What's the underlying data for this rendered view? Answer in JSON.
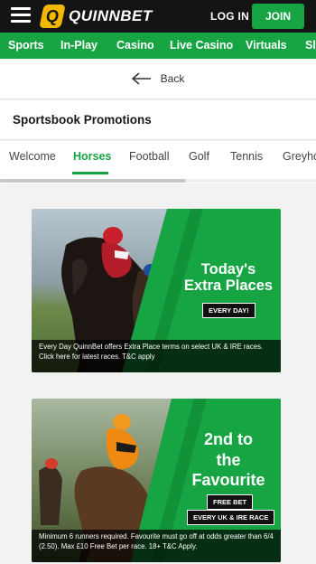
{
  "header": {
    "logo_letter": "Q",
    "logo_text": "QUINNBET",
    "login_label": "LOG IN",
    "join_label": "JOIN"
  },
  "nav": {
    "items": [
      "Sports",
      "In-Play",
      "Casino",
      "Live Casino",
      "Virtuals",
      "Sl"
    ]
  },
  "back": {
    "label": "Back"
  },
  "promotions": {
    "title": "Sportsbook Promotions"
  },
  "tabs": {
    "items": [
      "Welcome",
      "Horses",
      "Football",
      "Golf",
      "Tennis",
      "Greyho"
    ],
    "active": "Horses"
  },
  "cards": [
    {
      "headline_line1": "Today's",
      "headline_line2": "Extra Places",
      "badges": [
        "EVERY DAY!"
      ],
      "caption": "Every Day QuinnBet offers Extra Place terms on select UK & IRE races. Click here for latest races. T&C apply"
    },
    {
      "headline_line1": "2nd to",
      "headline_line2": "the",
      "headline_line3": "Favourite",
      "badges": [
        "FREE BET",
        "EVERY UK & IRE RACE"
      ],
      "caption": "Minimum 6 runners required. Favourite must go off at odds greater than 6/4 (2.50). Max £10 Free Bet per race. 18+ T&C Apply."
    }
  ],
  "colors": {
    "brand_green": "#17a544",
    "header_black": "#141414",
    "logo_yellow": "#f2b700"
  }
}
